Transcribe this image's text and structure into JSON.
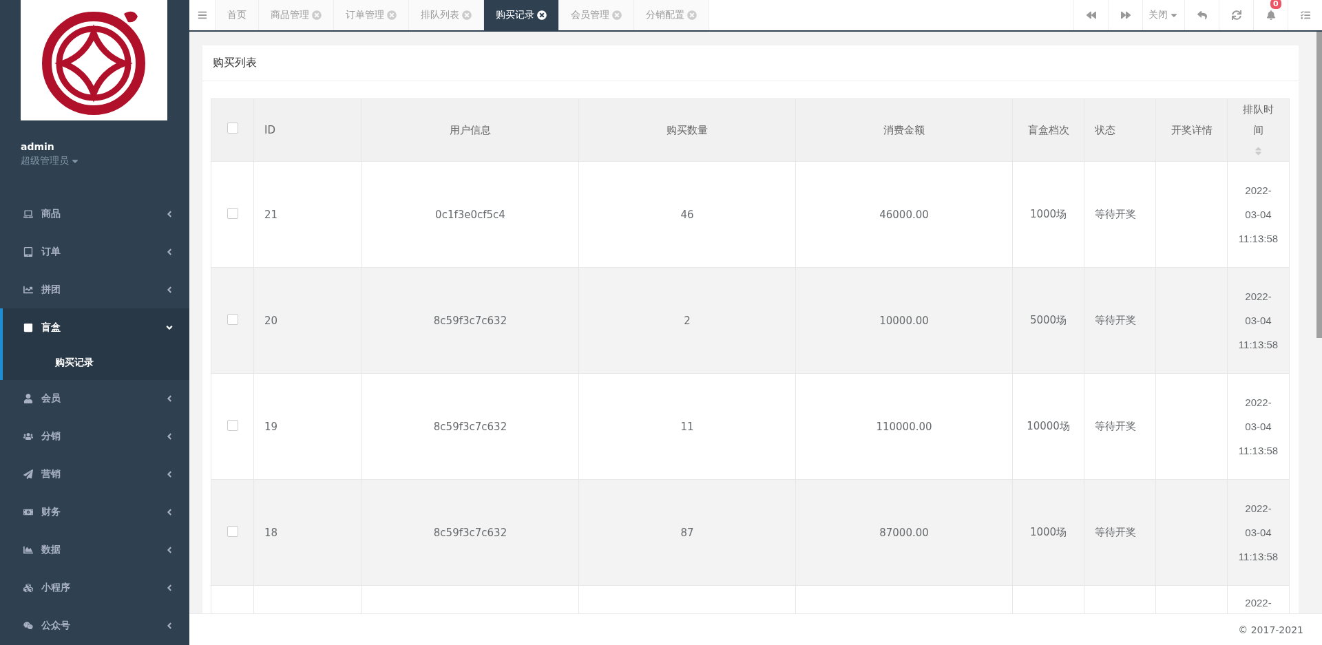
{
  "sidebar": {
    "user": {
      "name": "admin",
      "role": "超级管理员"
    },
    "menu": [
      {
        "label": "商品",
        "expanded": false,
        "selected": false
      },
      {
        "label": "订单",
        "expanded": false,
        "selected": false
      },
      {
        "label": "拼团",
        "expanded": false,
        "selected": false
      },
      {
        "label": "盲盒",
        "expanded": true,
        "selected": true,
        "children": [
          {
            "label": "购买记录",
            "selected": true
          }
        ]
      },
      {
        "label": "会员",
        "expanded": false,
        "selected": false
      },
      {
        "label": "分销",
        "expanded": false,
        "selected": false
      },
      {
        "label": "营销",
        "expanded": false,
        "selected": false
      },
      {
        "label": "财务",
        "expanded": false,
        "selected": false
      },
      {
        "label": "数据",
        "expanded": false,
        "selected": false
      },
      {
        "label": "小程序",
        "expanded": false,
        "selected": false
      },
      {
        "label": "公众号",
        "expanded": false,
        "selected": false
      }
    ]
  },
  "tabs": [
    {
      "label": "首页",
      "selected": false,
      "closable": false
    },
    {
      "label": "商品管理",
      "selected": false,
      "closable": true
    },
    {
      "label": "订单管理",
      "selected": false,
      "closable": true
    },
    {
      "label": "排队列表",
      "selected": false,
      "closable": true
    },
    {
      "label": "购买记录",
      "selected": true,
      "closable": true
    },
    {
      "label": "会员管理",
      "selected": false,
      "closable": true
    },
    {
      "label": "分销配置",
      "selected": false,
      "closable": true
    }
  ],
  "toolbar": {
    "close_menu": "关闭",
    "notification_count": "0"
  },
  "card": {
    "title": "购买列表"
  },
  "table": {
    "columns": [
      {
        "label": "ID",
        "sortable": false
      },
      {
        "label": "用户信息",
        "sortable": false
      },
      {
        "label": "购买数量",
        "sortable": false
      },
      {
        "label": "消费金额",
        "sortable": false
      },
      {
        "label": "盲盒档次",
        "sortable": false
      },
      {
        "label": "状态",
        "sortable": false
      },
      {
        "label": "开奖详情",
        "sortable": false
      },
      {
        "label": "排队时间",
        "sortable": true
      }
    ],
    "select_all_checked": false,
    "rows": [
      {
        "checked": false,
        "cells": [
          "21",
          "0c1f3e0cf5c4",
          "46",
          "46000.00",
          "1000场",
          "等待开奖",
          "",
          "2022-03-04 11:13:58"
        ]
      },
      {
        "checked": false,
        "cells": [
          "20",
          "8c59f3c7c632",
          "2",
          "10000.00",
          "5000场",
          "等待开奖",
          "",
          "2022-03-04 11:13:58"
        ]
      },
      {
        "checked": false,
        "cells": [
          "19",
          "8c59f3c7c632",
          "11",
          "110000.00",
          "10000场",
          "等待开奖",
          "",
          "2022-03-04 11:13:58"
        ]
      },
      {
        "checked": false,
        "cells": [
          "18",
          "8c59f3c7c632",
          "87",
          "87000.00",
          "1000场",
          "等待开奖",
          "",
          "2022-03-04 11:13:58"
        ]
      },
      {
        "cells": [
          "",
          "",
          "",
          "",
          "",
          "",
          "",
          "2022-"
        ]
      }
    ]
  },
  "footer": {
    "copyright": "© 2017-2021"
  }
}
